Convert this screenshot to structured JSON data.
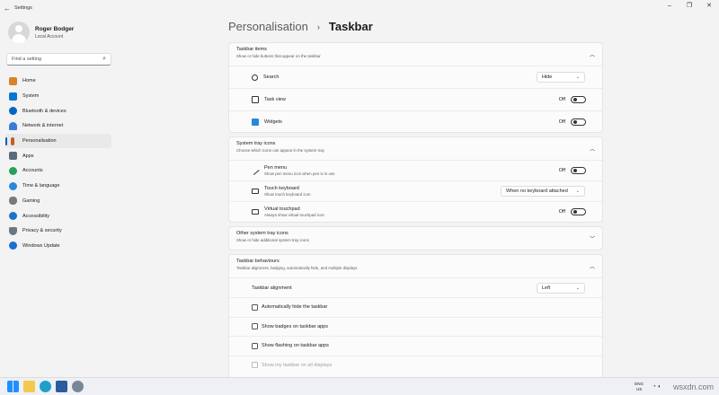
{
  "window": {
    "title": "Settings"
  },
  "profile": {
    "name": "Roger Bodger",
    "account": "Local Account"
  },
  "search": {
    "placeholder": "Find a setting"
  },
  "nav": [
    {
      "label": "Home",
      "color": "#d9822b"
    },
    {
      "label": "System",
      "color": "#0078d4"
    },
    {
      "label": "Bluetooth & devices",
      "color": "#0067c0"
    },
    {
      "label": "Network & internet",
      "color": "#3a7bd5"
    },
    {
      "label": "Personalisation",
      "color": "#c75b2a"
    },
    {
      "label": "Apps",
      "color": "#5a6b7c"
    },
    {
      "label": "Accounts",
      "color": "#2aa05a"
    },
    {
      "label": "Time & language",
      "color": "#2b88d8"
    },
    {
      "label": "Gaming",
      "color": "#7a7a7a"
    },
    {
      "label": "Accessibility",
      "color": "#1a73c9"
    },
    {
      "label": "Privacy & security",
      "color": "#6b7785"
    },
    {
      "label": "Windows Update",
      "color": "#1c6fd1"
    }
  ],
  "breadcrumb": {
    "parent": "Personalisation",
    "separator": "›",
    "current": "Taskbar"
  },
  "taskbar_items": {
    "title": "Taskbar items",
    "subtitle": "Show or hide buttons that appear on the taskbar",
    "search": {
      "label": "Search",
      "value": "Hide"
    },
    "task_view": {
      "label": "Task view",
      "state": "Off"
    },
    "widgets": {
      "label": "Widgets",
      "state": "Off"
    }
  },
  "tray_icons": {
    "title": "System tray icons",
    "subtitle": "Choose which icons can appear in the system tray",
    "pen": {
      "label": "Pen menu",
      "desc": "Show pen menu icon when pen is in use",
      "state": "Off"
    },
    "keyboard": {
      "label": "Touch keyboard",
      "desc": "Show touch keyboard icon",
      "value": "When no keyboard attached"
    },
    "touchpad": {
      "label": "Virtual touchpad",
      "desc": "Always show virtual touchpad icon",
      "state": "Off"
    }
  },
  "other_tray": {
    "title": "Other system tray icons",
    "subtitle": "Show or hide additional system tray icons"
  },
  "behaviours": {
    "title": "Taskbar behaviours",
    "subtitle": "Taskbar alignment, badging, automatically hide, and multiple displays",
    "alignment": {
      "label": "Taskbar alignment",
      "value": "Left"
    },
    "auto_hide": "Automatically hide the taskbar",
    "badges": "Show badges on taskbar apps",
    "flashing": "Show flashing on taskbar apps",
    "all_displays": "Show my taskbar on all displays"
  },
  "tray": {
    "lang_line1": "ENG",
    "lang_line2": "US",
    "watermark": "wsxdn.com"
  },
  "colors": {
    "accent": "#005fb8",
    "background": "#f3f3f3",
    "card": "#fbfbfb"
  }
}
